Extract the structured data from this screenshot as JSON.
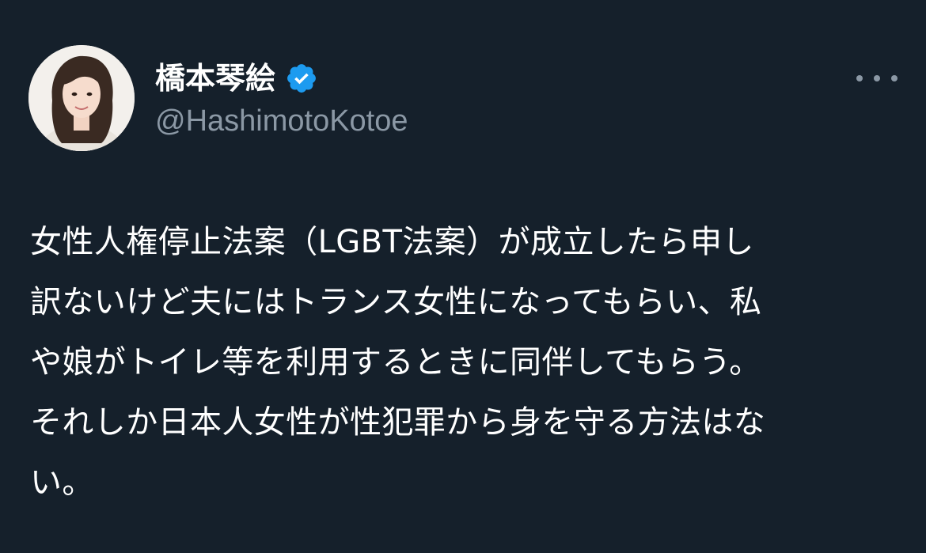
{
  "author": {
    "name": "橋本琴絵",
    "handle": "@HashimotoKotoe",
    "verified": true,
    "badge_color": "#1d9bf0",
    "avatar_icon": "profile-photo"
  },
  "actions": {
    "more_icon": "more-horizontal-icon"
  },
  "tweet": {
    "lines": [
      "女性人権停止法案（LGBT法案）が成立したら申し",
      "訳ないけど夫にはトランス女性になってもらい、私",
      "や娘がトイレ等を利用するときに同伴してもらう。",
      "それしか日本人女性が性犯罪から身を守る方法はな",
      "い。"
    ]
  },
  "colors": {
    "background": "#15202b",
    "text_primary": "#ffffff",
    "text_secondary": "#8b98a5"
  }
}
